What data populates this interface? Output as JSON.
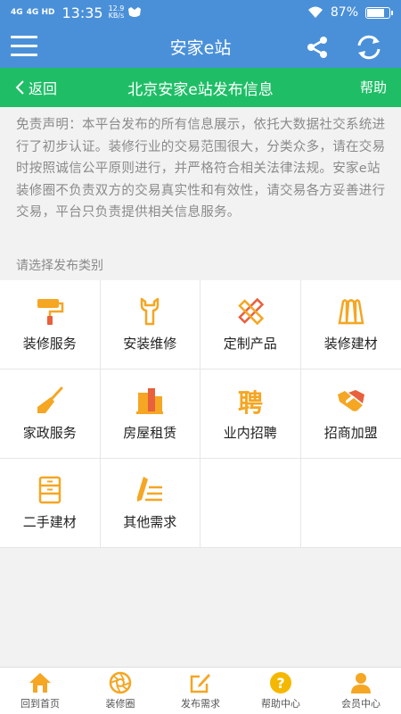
{
  "status_bar": {
    "network_1": "4G",
    "network_2": "4G HD",
    "time": "13:35",
    "speed_value": "12.9",
    "speed_unit": "KB/s",
    "battery_text": "87%",
    "battery_level": 0.87
  },
  "app_bar": {
    "title": "安家e站"
  },
  "sub_bar": {
    "back_label": "返回",
    "title": "北京安家e站发布信息",
    "help_label": "帮助"
  },
  "disclaimer": "免责声明：本平台发布的所有信息展示，依托大数据社交系统进行了初步认证。装修行业的交易范围很大，分类众多，请在交易时按照诚信公平原则进行，并严格符合相关法律法规。安家e站装修圈不负责双方的交易真实性和有效性，请交易各方妥善进行交易，平台只负责提供相关信息服务。",
  "section_label": "请选择发布类别",
  "categories": [
    {
      "label": "装修服务",
      "icon": "paint-roller-icon"
    },
    {
      "label": "安装维修",
      "icon": "wrench-icon"
    },
    {
      "label": "定制产品",
      "icon": "pencil-ruler-icon"
    },
    {
      "label": "装修建材",
      "icon": "building-materials-icon"
    },
    {
      "label": "家政服务",
      "icon": "broom-icon"
    },
    {
      "label": "房屋租赁",
      "icon": "buildings-icon"
    },
    {
      "label": "业内招聘",
      "icon": "recruit-icon"
    },
    {
      "label": "招商加盟",
      "icon": "handshake-icon"
    },
    {
      "label": "二手建材",
      "icon": "cabinet-icon"
    },
    {
      "label": "其他需求",
      "icon": "list-pen-icon"
    }
  ],
  "bottom_nav": [
    {
      "label": "回到首页",
      "icon": "home-icon"
    },
    {
      "label": "装修圈",
      "icon": "aperture-icon"
    },
    {
      "label": "发布需求",
      "icon": "edit-icon"
    },
    {
      "label": "帮助中心",
      "icon": "help-icon"
    },
    {
      "label": "会员中心",
      "icon": "user-icon"
    }
  ],
  "colors": {
    "app_bar": "#4a90d9",
    "sub_bar": "#1fbe66",
    "icon_orange": "#f5a623",
    "icon_red": "#e8603c"
  }
}
